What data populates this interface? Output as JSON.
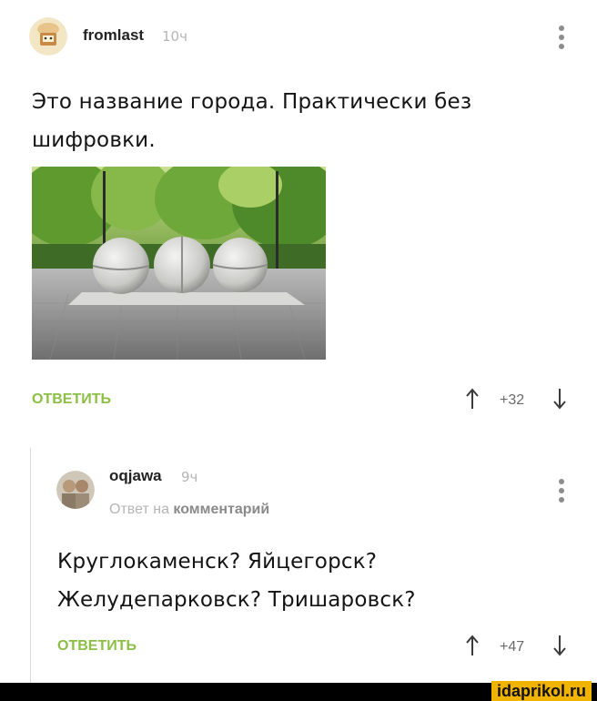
{
  "post": {
    "username": "fromlast",
    "time": "10ч",
    "text_line1": "Это название города. Практически без",
    "text_line2": "шифровки.",
    "reply_label": "ОТВЕТИТЬ",
    "rating": "+32"
  },
  "comment": {
    "username": "oqjawa",
    "time": "9ч",
    "reply_to_prefix": "Ответ на",
    "reply_to_link": "комментарий",
    "text_line1": "Круглокаменск? Яйцегорск?",
    "text_line2": "Желудепарковск? Тришаровск?",
    "reply_label": "ОТВЕТИТЬ",
    "rating": "+47"
  },
  "watermark": "idaprikol.ru",
  "icons": [
    "avatar",
    "more-dots-icon",
    "upvote-arrow-icon",
    "downvote-arrow-icon"
  ],
  "colors": {
    "accent": "#8bbf45",
    "muted": "#b5b5b5",
    "watermark_bg": "#f0b400"
  }
}
